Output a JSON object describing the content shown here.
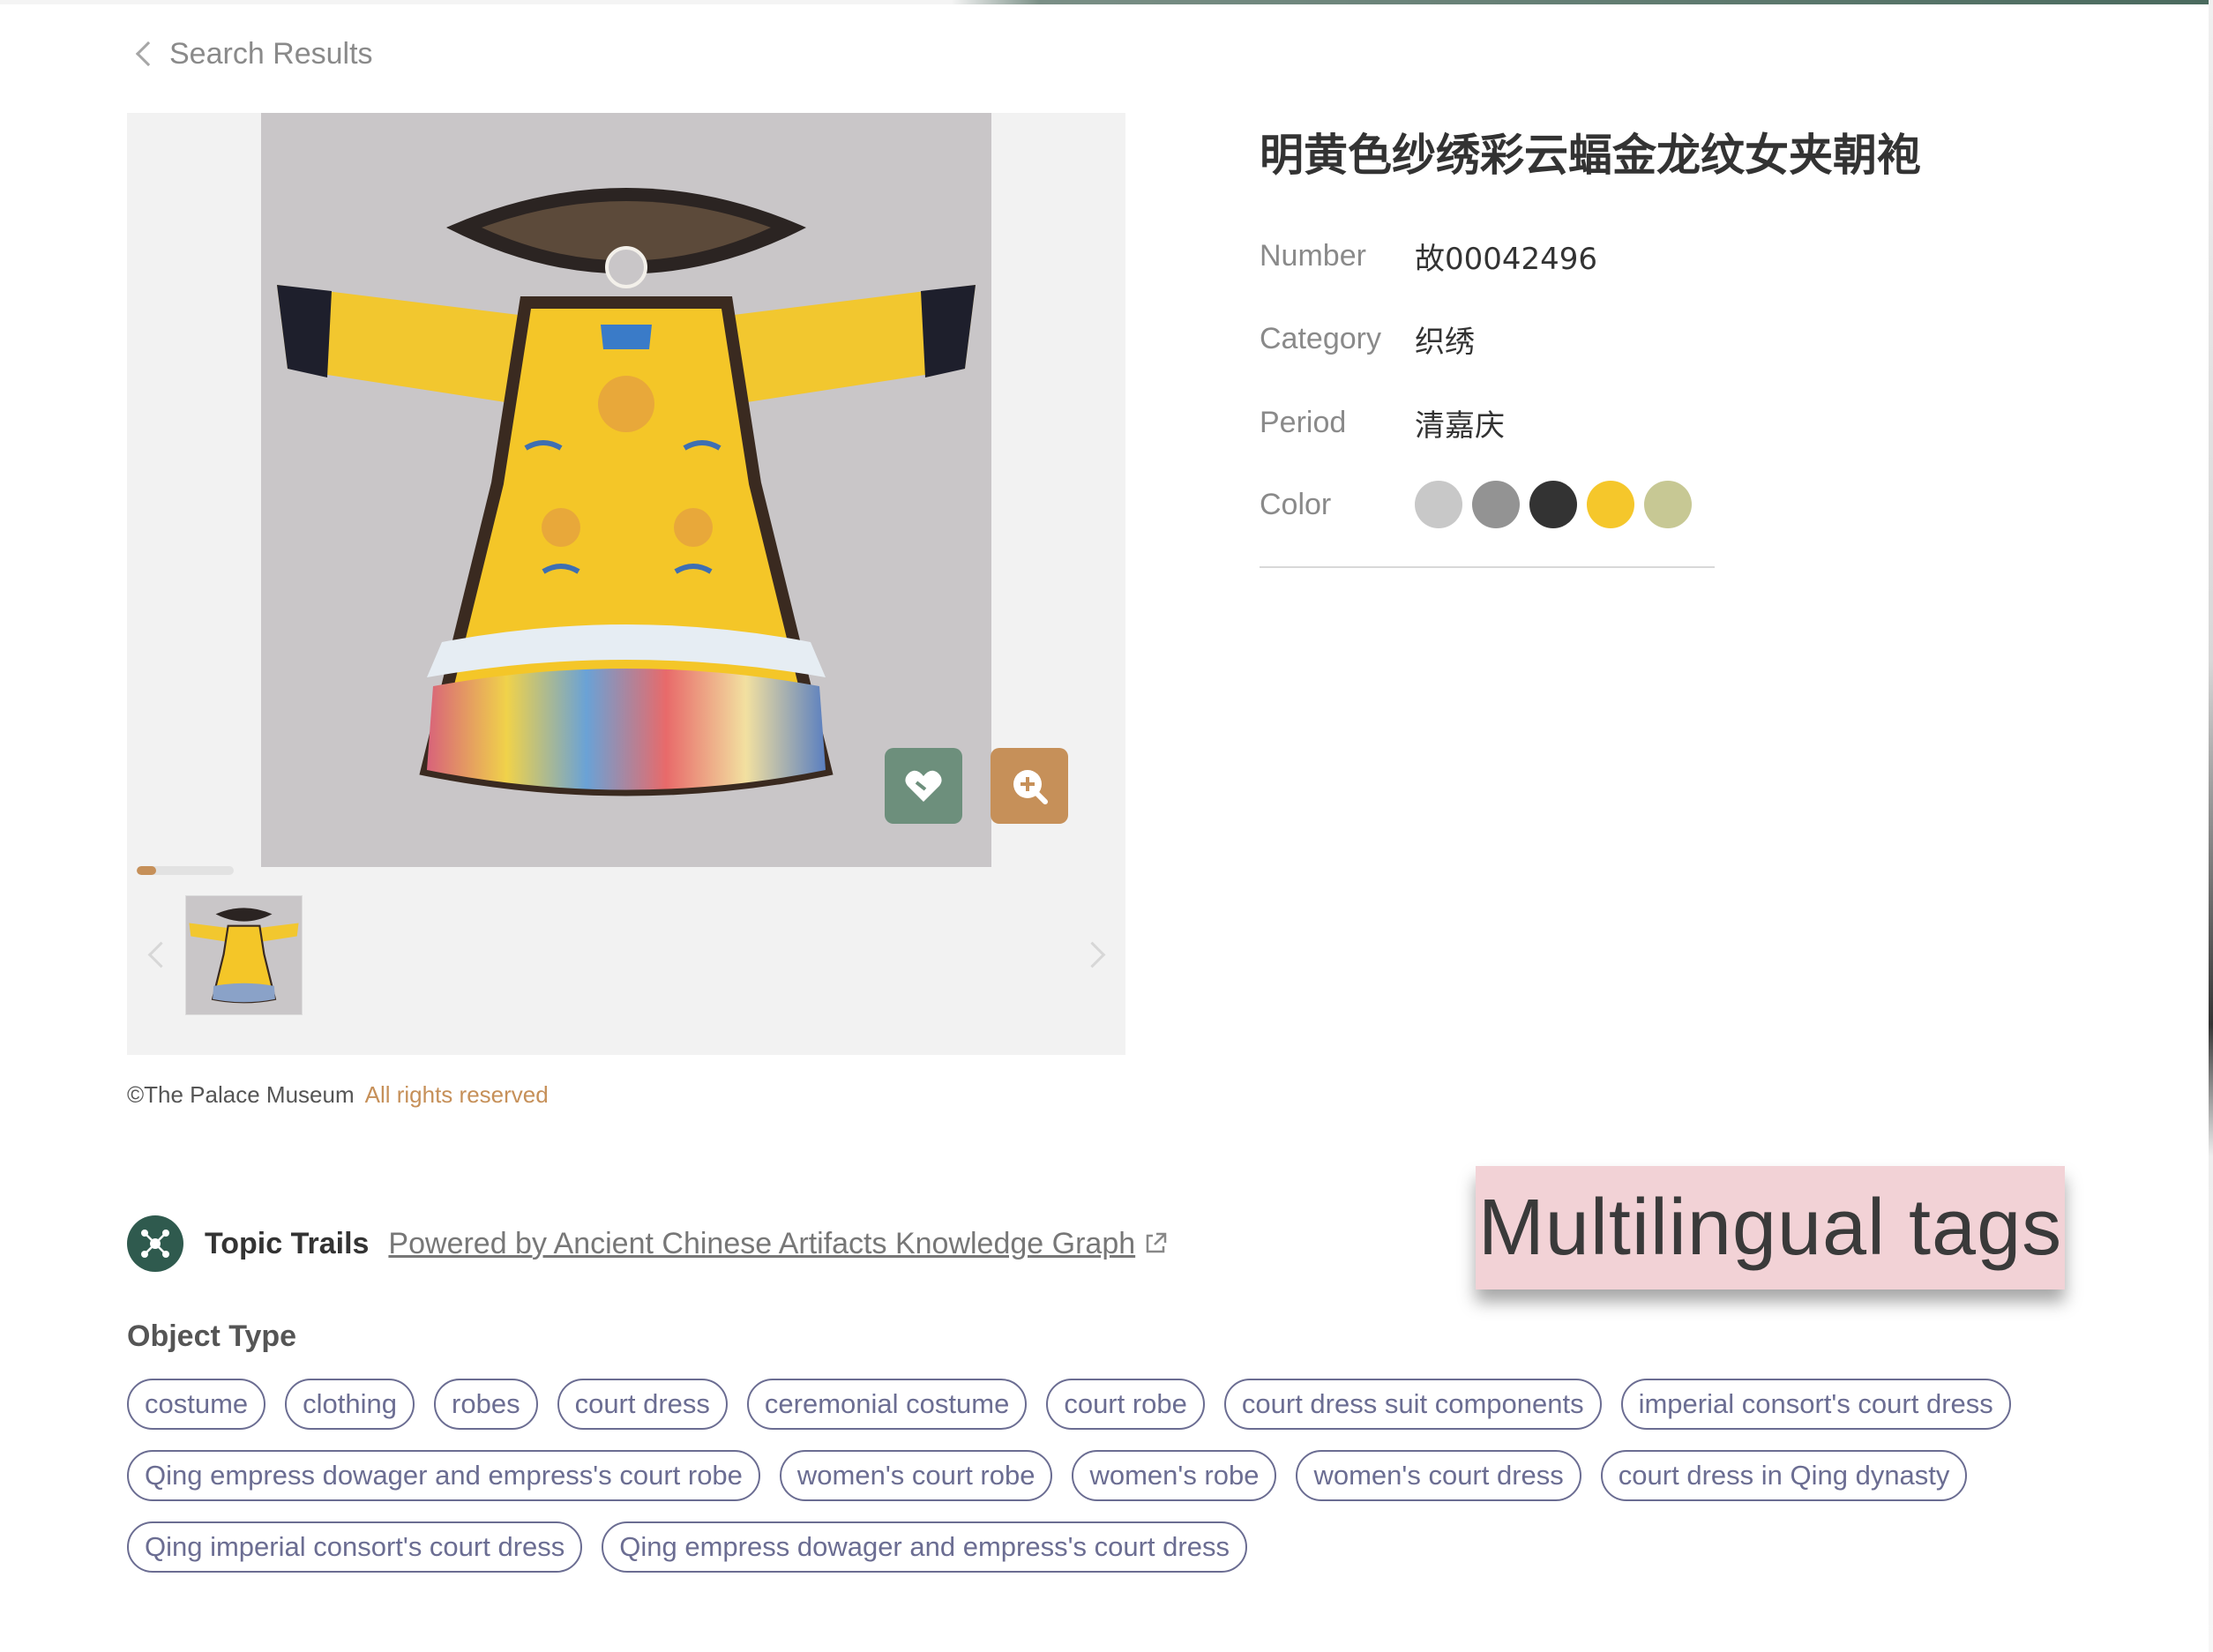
{
  "nav": {
    "back_label": "Search Results"
  },
  "artifact": {
    "title": "明黄色纱绣彩云蝠金龙纹女夹朝袍",
    "fields": [
      {
        "label": "Number",
        "value": "故00042496"
      },
      {
        "label": "Category",
        "value": "织绣"
      },
      {
        "label": "Period",
        "value": "清嘉庆"
      }
    ],
    "color_label": "Color",
    "colors": [
      "#c8c8c8",
      "#939393",
      "#333333",
      "#f5c72b",
      "#c7c894"
    ]
  },
  "gallery": {
    "progress": 0.2,
    "actions": {
      "favorite_icon": "heart-icon",
      "zoom_icon": "zoom-in-icon"
    }
  },
  "copyright": {
    "owner": "©The Palace Museum",
    "rights": "All rights reserved"
  },
  "annotation": {
    "text": "Multilingual tags"
  },
  "topic_trails": {
    "title": "Topic Trails",
    "link_text": "Powered by Ancient Chinese Artifacts Knowledge Graph"
  },
  "object_type": {
    "heading": "Object Type",
    "rows": [
      [
        "costume",
        "clothing",
        "robes",
        "court dress",
        "ceremonial costume",
        "court robe",
        "court dress suit components",
        "imperial consort's court dress"
      ],
      [
        "Qing empress dowager and empress's court robe",
        "women's court robe",
        "women's robe",
        "women's court dress",
        "court dress in Qing dynasty"
      ],
      [
        "Qing imperial consort's court dress",
        "Qing empress dowager and empress's court dress"
      ]
    ]
  }
}
